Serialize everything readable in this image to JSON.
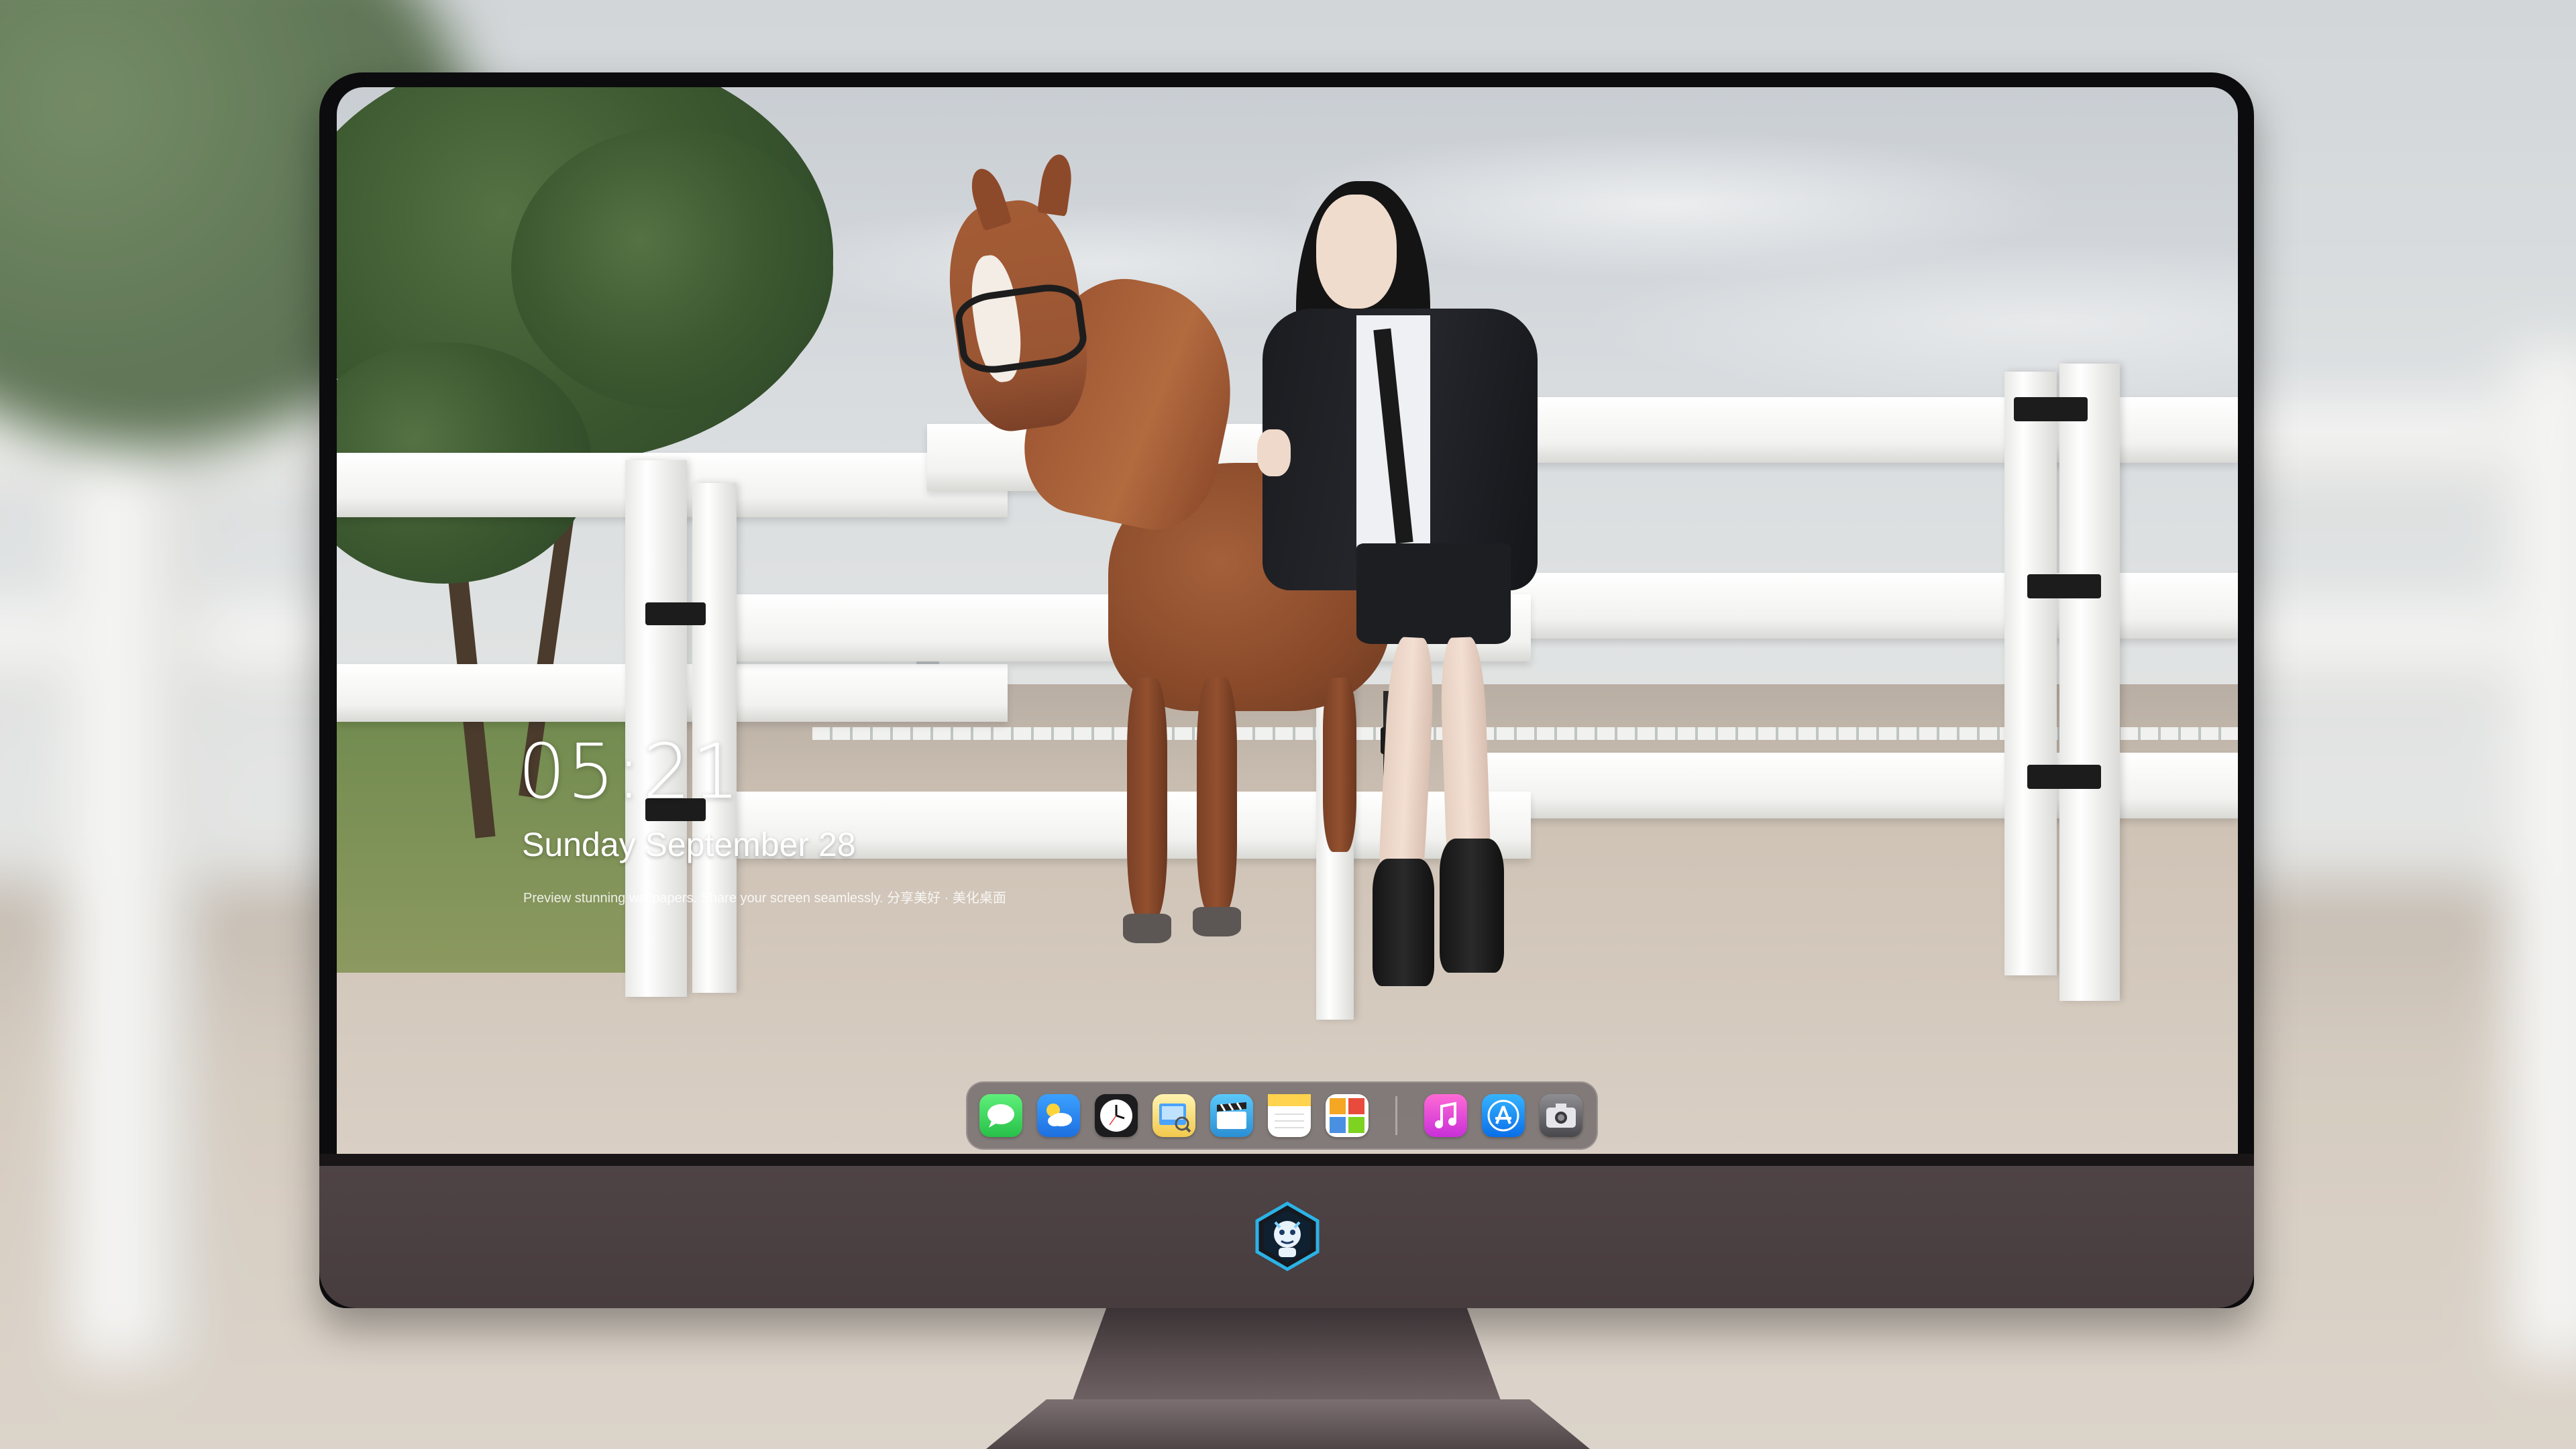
{
  "lockscreen": {
    "time": "05:21",
    "date": "Sunday September  28",
    "tagline": "Preview stunning wallpapers. Share your screen seamlessly. 分享美好 · 美化桌面"
  },
  "dock": {
    "apps": [
      {
        "name": "Messages",
        "icon": "messages-icon",
        "color": "#34c759"
      },
      {
        "name": "Weather",
        "icon": "weather-icon",
        "color": "#2f8cf5"
      },
      {
        "name": "Clock",
        "icon": "clock-icon",
        "color": "#1c1c1e"
      },
      {
        "name": "Preview",
        "icon": "preview-icon",
        "color": "#f4d250"
      },
      {
        "name": "Clips",
        "icon": "clips-icon",
        "color": "#34aadc"
      },
      {
        "name": "Notes",
        "icon": "notes-icon",
        "color": "#ffd34d"
      },
      {
        "name": "Photo Booth",
        "icon": "photo-booth-icon",
        "color": "#e84b3c"
      },
      {
        "name": "Music",
        "icon": "music-icon",
        "color": "#e641c8"
      },
      {
        "name": "App Store",
        "icon": "app-store-icon",
        "color": "#1a8cff"
      },
      {
        "name": "Camera",
        "icon": "camera-icon",
        "color": "#6e6e73"
      }
    ]
  },
  "monitor": {
    "logo": "dragon-mascot-logo",
    "chin_color": "#4a3f41"
  },
  "wallpaper": {
    "subject": "woman-leaning-on-white-fence-beside-horse"
  }
}
